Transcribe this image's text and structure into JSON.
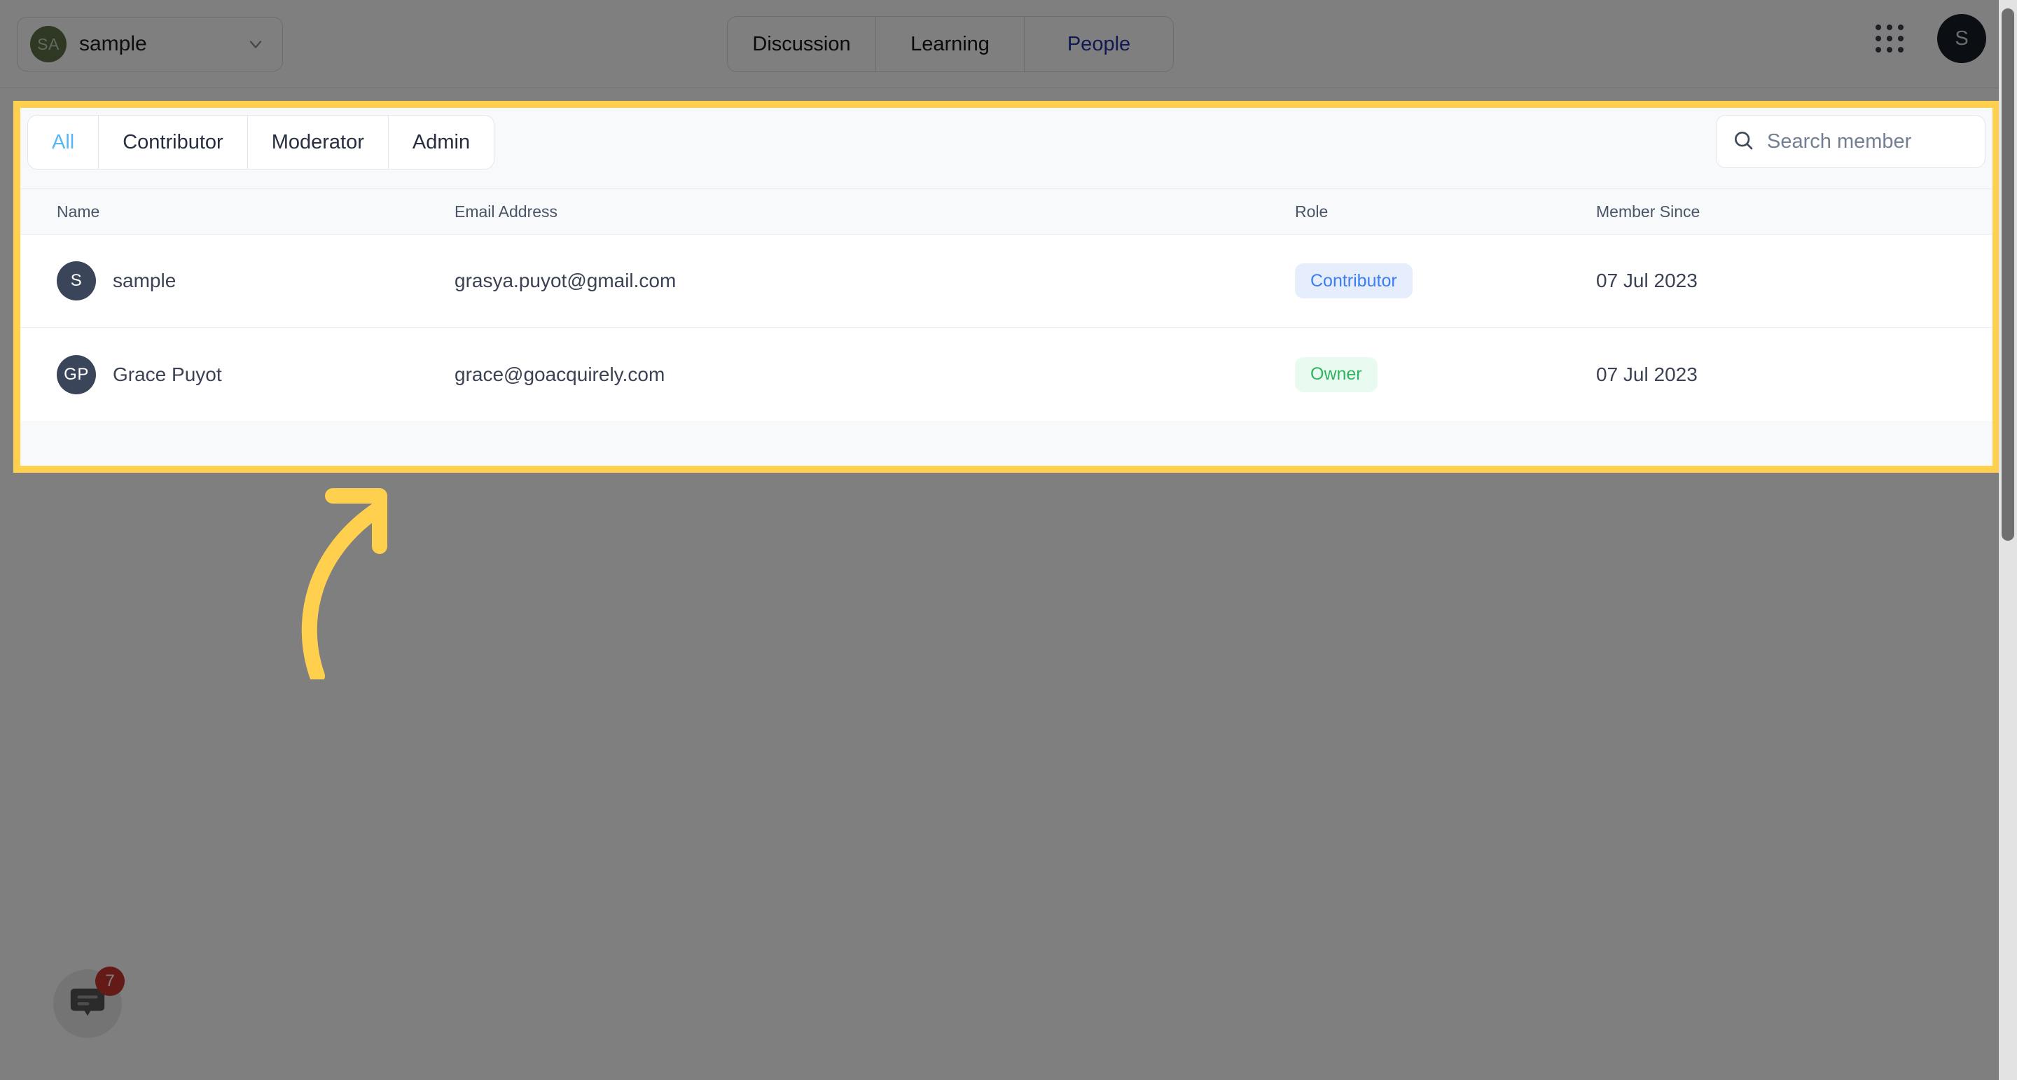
{
  "header": {
    "workspace": {
      "initials": "SA",
      "name": "sample",
      "chevron_icon": "chevron-down-icon"
    },
    "nav_tabs": [
      {
        "label": "Discussion",
        "active": false
      },
      {
        "label": "Learning",
        "active": false
      },
      {
        "label": "People",
        "active": true
      }
    ],
    "apps_icon": "apps-grid-icon",
    "user_avatar_initial": "S"
  },
  "panel": {
    "filter_tabs": [
      {
        "label": "All",
        "active": true
      },
      {
        "label": "Contributor",
        "active": false
      },
      {
        "label": "Moderator",
        "active": false
      },
      {
        "label": "Admin",
        "active": false
      }
    ],
    "search": {
      "icon": "search-icon",
      "placeholder": "Search member",
      "value": ""
    },
    "table": {
      "columns": [
        "Name",
        "Email Address",
        "Role",
        "Member Since"
      ],
      "rows": [
        {
          "initials": "S",
          "name": "sample",
          "email": "grasya.puyot@gmail.com",
          "role": "Contributor",
          "role_style": "contributor",
          "member_since": "07 Jul 2023"
        },
        {
          "initials": "GP",
          "name": "Grace Puyot",
          "email": "grace@goacquirely.com",
          "role": "Owner",
          "role_style": "owner",
          "member_since": "07 Jul 2023"
        }
      ]
    }
  },
  "annotation": {
    "arrow_icon": "curved-arrow-up-right-icon",
    "highlight_color": "#ffd04d"
  },
  "chat_launcher": {
    "icon": "chat-bubble-icon",
    "unread_count": "7"
  },
  "colors": {
    "highlight": "#ffd04d",
    "active_tab": "#5bb6f2",
    "nav_active": "#2431a4",
    "badge_contributor_bg": "#e6eefd",
    "badge_contributor_text": "#3d7ef5",
    "badge_owner_bg": "#e9faf0",
    "badge_owner_text": "#2fb55f"
  }
}
